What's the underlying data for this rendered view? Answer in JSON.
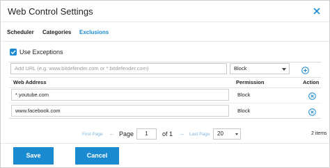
{
  "dialog": {
    "title": "Web Control Settings",
    "close_icon": "close-icon"
  },
  "tabs": [
    {
      "label": "Scheduler",
      "active": false
    },
    {
      "label": "Categories",
      "active": false
    },
    {
      "label": "Exclusions",
      "active": true
    }
  ],
  "exceptions": {
    "checkbox_checked": true,
    "label": "Use Exceptions"
  },
  "add_row": {
    "url_placeholder": "Add URL (e.g. www.bitdefender.com or *.bitdefender.com)",
    "permission_value": "Block",
    "add_icon": "plus-circle-icon"
  },
  "table": {
    "columns": [
      "Web Address",
      "Permission",
      "Action"
    ],
    "rows": [
      {
        "url": "*.youtube.com",
        "permission": "Block",
        "action_icon": "remove-circle-icon"
      },
      {
        "url": "www.facebook.com",
        "permission": "Block",
        "action_icon": "remove-circle-icon"
      }
    ]
  },
  "pagination": {
    "first_label": "First Page",
    "prev_symbol": "←",
    "page_label": "Page",
    "page_value": "1",
    "of_label": "of 1",
    "next_symbol": "→",
    "last_label": "Last Page",
    "page_size": "20",
    "count_label": "2 items"
  },
  "footer": {
    "save_label": "Save",
    "cancel_label": "Cancel"
  },
  "colors": {
    "accent": "#1a8ad1",
    "link_muted": "#7fb6da"
  }
}
